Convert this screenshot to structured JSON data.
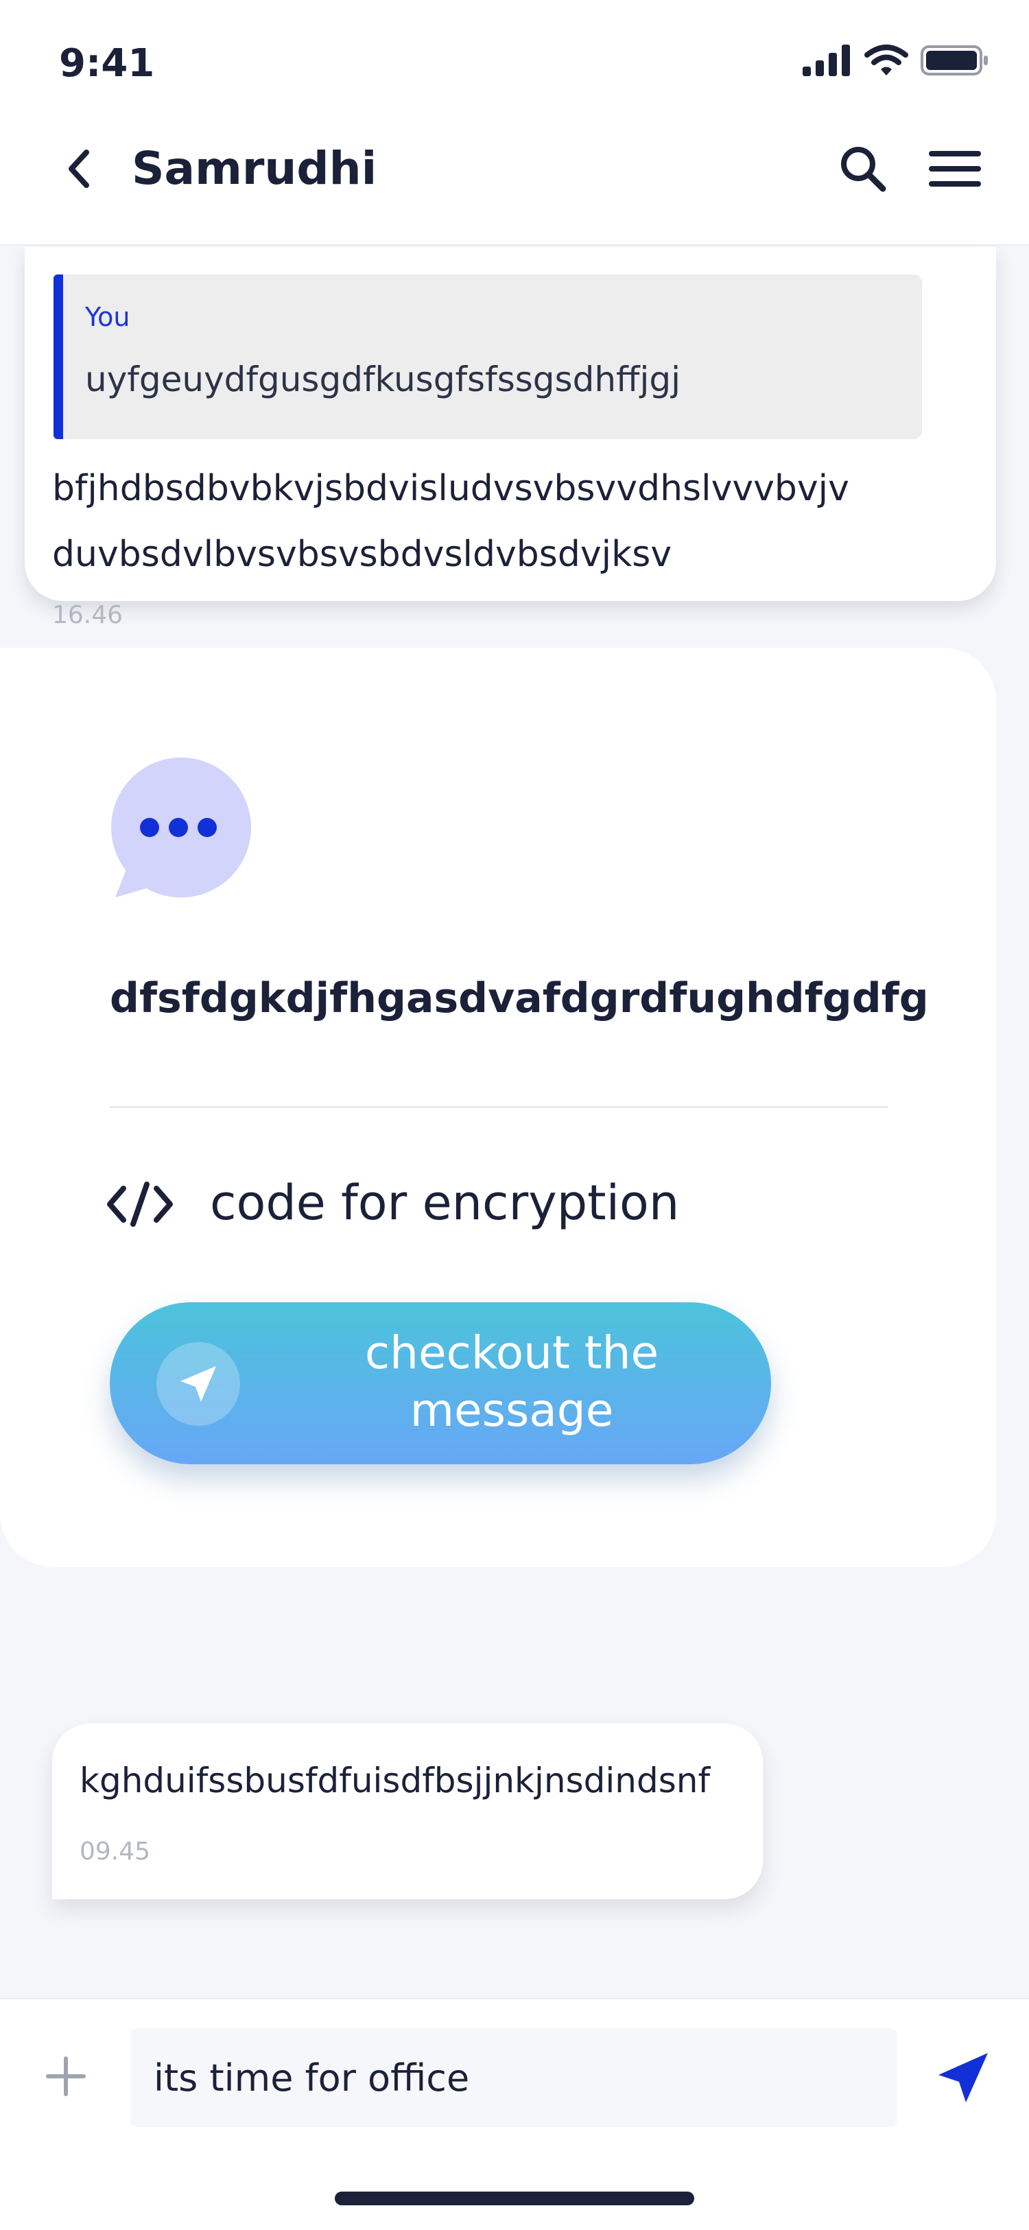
{
  "status_bar": {
    "time": "9:41"
  },
  "header": {
    "title": "Samrudhi"
  },
  "reply_message": {
    "quote_author": "You",
    "quote_text": "uyfgeuydfgusgdfkusgfsfssgsdhffjgj",
    "text": "bfjhdbsdbvbkvjsbdvisludvsvbsvvdhslvvvbvjv duvbsdvlbvsvbsvsbdvsldvbsdvjksv",
    "time": "16.46"
  },
  "card": {
    "title": "dfsfdgkdjfhgasdvafdgrdfughdfgdfg",
    "code_label": "code for encryption",
    "button_label": "checkout the message"
  },
  "incoming_message": {
    "text": "kghduifssbusfdfuisdfbsjjnkjnsdindsnf",
    "time": "09.45"
  },
  "composer": {
    "input_value": "its time for office"
  },
  "icons": {
    "back": "chevron-left-icon",
    "search": "search-icon",
    "menu": "hamburger-menu-icon",
    "bubble": "chat-bubble-icon",
    "code": "code-icon",
    "send": "send-icon",
    "plus": "plus-icon"
  },
  "colors": {
    "accent": "#1230d8",
    "button_gradient_top": "#4cc3db",
    "button_gradient_bottom": "#67a7f6",
    "bubble_icon_bg": "#d3d4fb"
  }
}
